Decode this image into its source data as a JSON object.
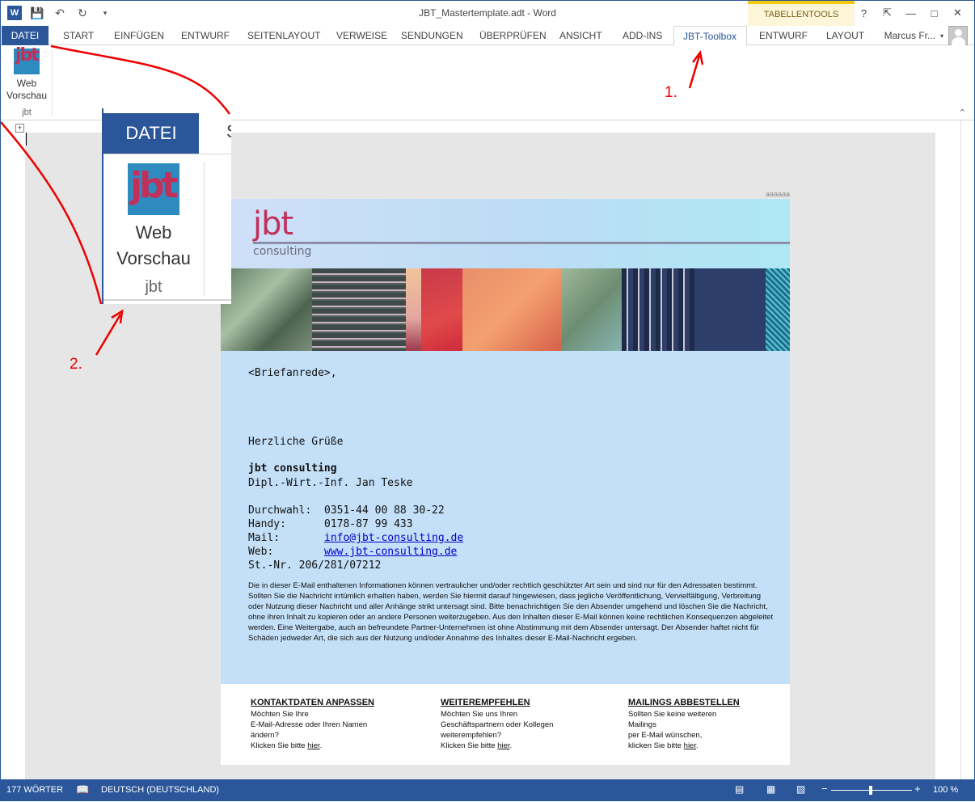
{
  "titlebar": {
    "title": "JBT_Mastertemplate.adt - Word",
    "context_group": "TABELLENTOOLS",
    "help": "?"
  },
  "tabs": {
    "file": "DATEI",
    "items": [
      "START",
      "EINFÜGEN",
      "ENTWURF",
      "SEITENLAYOUT",
      "VERWEISE",
      "SENDUNGEN",
      "ÜBERPRÜFEN",
      "ANSICHT",
      "ADD-INS",
      "JBT-Toolbox",
      "ENTWURF",
      "LAYOUT"
    ],
    "active": "JBT-Toolbox",
    "user": "Marcus Fr..."
  },
  "ribbon": {
    "button_label_1": "Web",
    "button_label_2": "Vorschau",
    "group": "jbt",
    "logo_text": "jbt"
  },
  "zoom_callout": {
    "tab": "DATEI",
    "next_tab_fragment": "S",
    "label_1": "Web",
    "label_2": "Vorschau",
    "group": "jbt"
  },
  "annotations": {
    "one": "1.",
    "two": "2."
  },
  "document": {
    "page_marker": "aaaaaa",
    "brand": "jbt",
    "brand_sub": "consulting",
    "salutation": "<Briefanrede>,",
    "greeting": "Herzliche Grüße",
    "company": "jbt consulting",
    "name": "Dipl.-Wirt.-Inf. Jan Teske",
    "contact": [
      {
        "key": "Durchwahl:",
        "value": "0351-44 00 88 30-22",
        "link": false
      },
      {
        "key": "Handy:",
        "value": "0178-87 99 433",
        "link": false
      },
      {
        "key": "Mail:",
        "value": "info@jbt-consulting.de",
        "link": true
      },
      {
        "key": "Web:",
        "value": "www.jbt-consulting.de",
        "link": true
      }
    ],
    "tax": "St.-Nr. 206/281/07212",
    "disclaimer": "Die in dieser E-Mail enthaltenen Informationen können vertraulicher und/oder rechtlich geschützter Art sein und sind nur für den Adressaten bestimmt. Sollten Sie die Nachricht irrtümlich erhalten haben, werden Sie hiermit darauf hingewiesen, dass jegliche Veröffentlichung, Vervielfältigung, Verbreitung oder Nutzung dieser Nachricht und aller Anhänge strikt untersagt sind. Bitte benachrichtigen Sie den Absender umgehend und löschen Sie die Nachricht, ohne ihren Inhalt zu kopieren oder an andere Personen weiterzugeben. Aus den Inhalten dieser E-Mail können keine rechtlichen Konsequenzen abgeleitet werden. Eine Weitergabe, auch an befreundete Partner-Unternehmen ist ohne Abstimmung mit dem Absender untersagt. Der Absender haftet nicht für Schäden jedweder Art, die sich aus der Nutzung und/oder Annahme des Inhaltes dieser E-Mail-Nachricht ergeben.",
    "footer": [
      {
        "heading": "KONTAKTDATEN ANPASSEN",
        "lines": [
          "Möchten Sie Ihre",
          "E-Mail-Adresse oder Ihren Namen",
          "ändern?"
        ],
        "click": "Klicken Sie bitte ",
        "link": "hier",
        "end": "."
      },
      {
        "heading": "WEITEREMPFEHLEN",
        "lines": [
          "Möchten Sie uns Ihren",
          "Geschäftspartnern oder Kollegen",
          "weiterempfehlen?"
        ],
        "click": "Klicken Sie bitte ",
        "link": "hier",
        "end": "."
      },
      {
        "heading": "MAILINGS ABBESTELLEN",
        "lines": [
          "Sollten Sie keine weiteren",
          "Mailings",
          "per E-Mail wünschen,"
        ],
        "click": "klicken Sie bitte ",
        "link": "hier",
        "end": "."
      }
    ]
  },
  "status": {
    "words": "177 WÖRTER",
    "language": "DEUTSCH (DEUTSCHLAND)",
    "zoom": "100 %",
    "zoom_percent": 100
  },
  "colors": {
    "accent": "#2b579a",
    "brand_red": "#c2305a",
    "annotation": "#e00000",
    "mail_bg": "#c3e0f8"
  }
}
